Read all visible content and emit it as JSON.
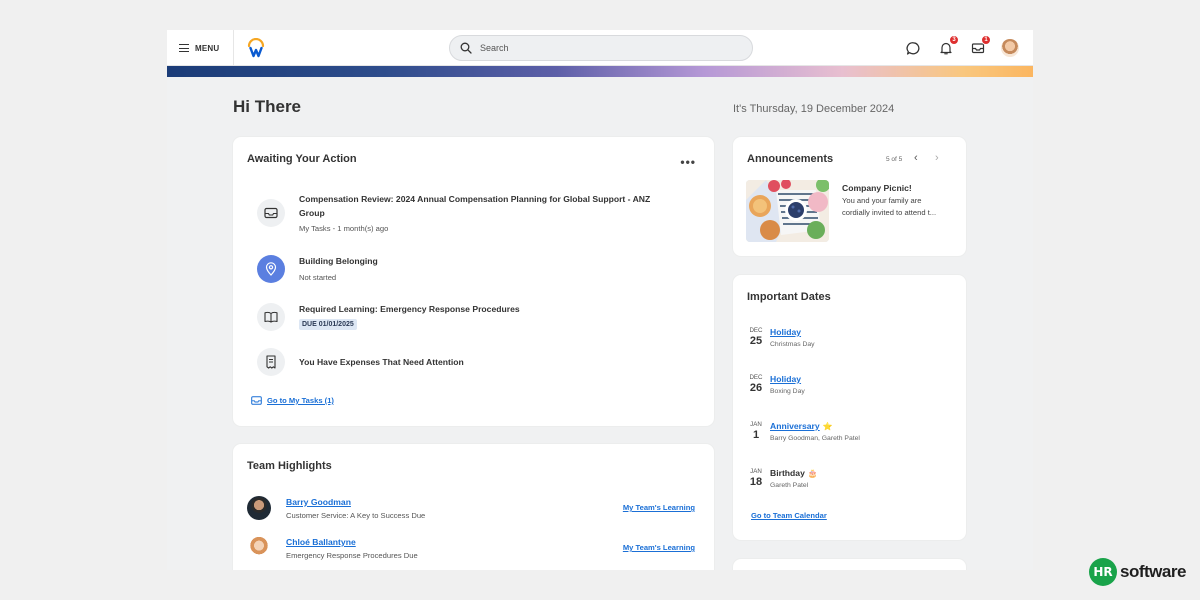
{
  "header": {
    "menu_label": "MENU",
    "search_placeholder": "Search",
    "notifications_count": "3",
    "inbox_count": "1"
  },
  "page": {
    "greeting": "Hi There",
    "date_text": "It's Thursday, 19 December 2024"
  },
  "awaiting": {
    "title": "Awaiting Your Action",
    "more_label": "•••",
    "tasks": [
      {
        "icon": "inbox-tray-icon",
        "title_line1": "Compensation Review: 2024 Annual Compensation Planning for Global Support - ANZ",
        "title_line2": "Group",
        "subtitle": "My Tasks - 1 month(s) ago"
      },
      {
        "icon": "location-pin-icon",
        "title": "Building Belonging",
        "subtitle": "Not started"
      },
      {
        "icon": "open-book-icon",
        "title": "Required Learning: Emergency Response Procedures",
        "due_badge": "DUE 01/01/2025"
      },
      {
        "icon": "receipt-icon",
        "title": "You Have Expenses That Need Attention"
      }
    ],
    "goto_label": "Go to My Tasks (1)"
  },
  "team": {
    "title": "Team Highlights",
    "members": [
      {
        "name": "Barry Goodman",
        "subtitle": "Customer Service: A Key to Success Due",
        "link": "My Team's Learning"
      },
      {
        "name": "Chloé Ballantyne",
        "subtitle": "Emergency Response Procedures Due",
        "link": "My Team's Learning"
      }
    ]
  },
  "announcements": {
    "title": "Announcements",
    "count": "5 of 5",
    "prev_icon": "chevron-left-icon",
    "next_icon": "chevron-right-icon",
    "item_title": "Company Picnic!",
    "item_text_line1": "You and your family are",
    "item_text_line2": "cordially invited to attend t..."
  },
  "important_dates": {
    "title": "Important Dates",
    "items": [
      {
        "month": "DEC",
        "day": "25",
        "title": "Holiday",
        "subtitle": "Christmas Day",
        "link": true
      },
      {
        "month": "DEC",
        "day": "26",
        "title": "Holiday",
        "subtitle": "Boxing Day",
        "link": true
      },
      {
        "month": "JAN",
        "day": "1",
        "title": "Anniversary",
        "subtitle": "Barry Goodman, Gareth Patel",
        "link": true,
        "emoji": "⭐"
      },
      {
        "month": "JAN",
        "day": "18",
        "title": "Birthday",
        "subtitle": "Gareth Patel",
        "link": false,
        "emoji": "🎂"
      }
    ],
    "goto_label": "Go to Team Calendar"
  },
  "brand": {
    "mark": "HR",
    "text": "software"
  },
  "colors": {
    "link": "#1a6fd6",
    "badge": "#de2f2f",
    "brand_green": "#19a34a",
    "accent_blue": "#5b7fe0"
  }
}
